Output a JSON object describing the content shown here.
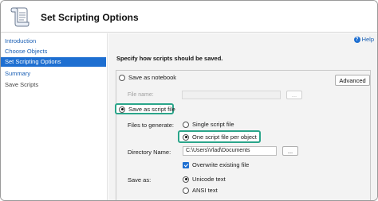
{
  "header": {
    "title": "Set Scripting Options",
    "icon": "scroll-icon"
  },
  "sidebar": {
    "items": [
      {
        "label": "Introduction",
        "state": "link"
      },
      {
        "label": "Choose Objects",
        "state": "link"
      },
      {
        "label": "Set Scripting Options",
        "state": "active"
      },
      {
        "label": "Summary",
        "state": "link"
      },
      {
        "label": "Save Scripts",
        "state": "disabled"
      }
    ]
  },
  "main": {
    "help_label": "Help",
    "instruction": "Specify how scripts should be saved.",
    "save_as_notebook": {
      "label": "Save as notebook",
      "selected": false
    },
    "advanced_button": "Advanced",
    "file_name": {
      "label": "File name:",
      "value": "",
      "browse": "..."
    },
    "save_as_script": {
      "label": "Save as script file",
      "selected": true
    },
    "files_to_generate": {
      "label": "Files to generate:",
      "options": [
        {
          "label": "Single script file",
          "selected": false
        },
        {
          "label": "One script file per object",
          "selected": true
        }
      ]
    },
    "directory": {
      "label": "Directory Name:",
      "value": "C:\\Users\\Vlad\\Documents",
      "browse": "..."
    },
    "overwrite": {
      "label": "Overwrite existing file",
      "checked": true
    },
    "save_as": {
      "label": "Save as:",
      "options": [
        {
          "label": "Unicode text",
          "selected": true
        },
        {
          "label": "ANSI text",
          "selected": false
        }
      ]
    }
  },
  "colors": {
    "accent": "#1e6fd1",
    "highlight": "#2aa58a",
    "link": "#1a5fb4"
  }
}
